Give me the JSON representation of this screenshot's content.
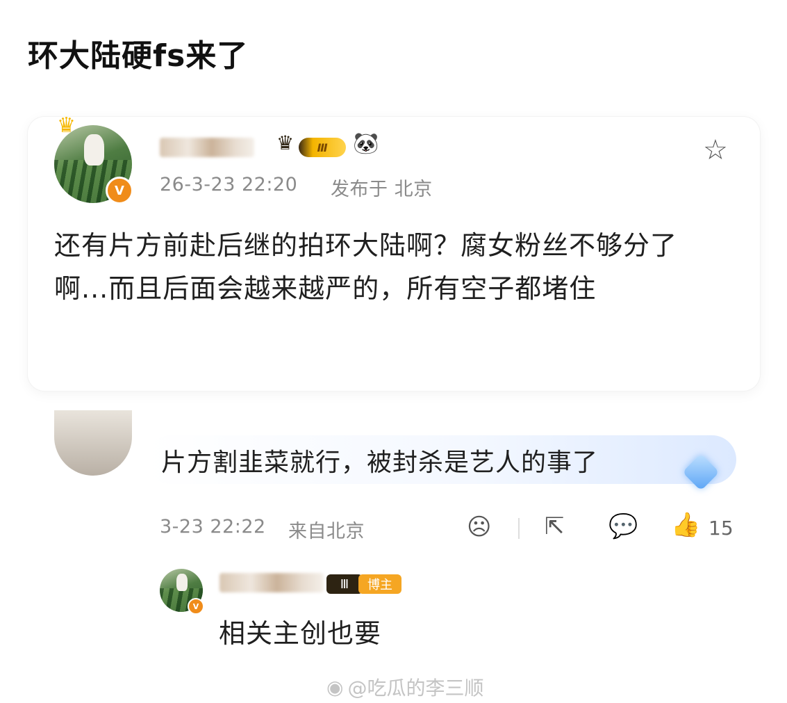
{
  "title": "环大陆硬fs来了",
  "post": {
    "date": "26-3-23 22:20",
    "location": "发布于 北京",
    "text": "还有片方前赴后继的拍环大陆啊？腐女粉丝不够分了啊...而且后面会越来越严的，所有空子都堵住",
    "level_badge": "Ⅲ",
    "verified_mark": "V",
    "icons": [
      "crown-icon",
      "panda-icon",
      "star-icon"
    ]
  },
  "reply": {
    "text": "片方割韭菜就行，被封杀是艺人的事了",
    "time": "3-23 22:22",
    "location": "来自北京",
    "like_count": "15",
    "icons": [
      "sad-face-icon",
      "share-icon",
      "comment-icon",
      "thumbs-up-icon",
      "diamond-icon"
    ]
  },
  "sub_reply": {
    "badge": "博主",
    "level": "Ⅲ",
    "text": "相关主创也要"
  },
  "watermark": "@吃瓜的李三顺",
  "colors": {
    "accent_orange": "#f08c1a",
    "meta_gray": "#8a8a8a",
    "blogger_badge": "#f5a623"
  }
}
